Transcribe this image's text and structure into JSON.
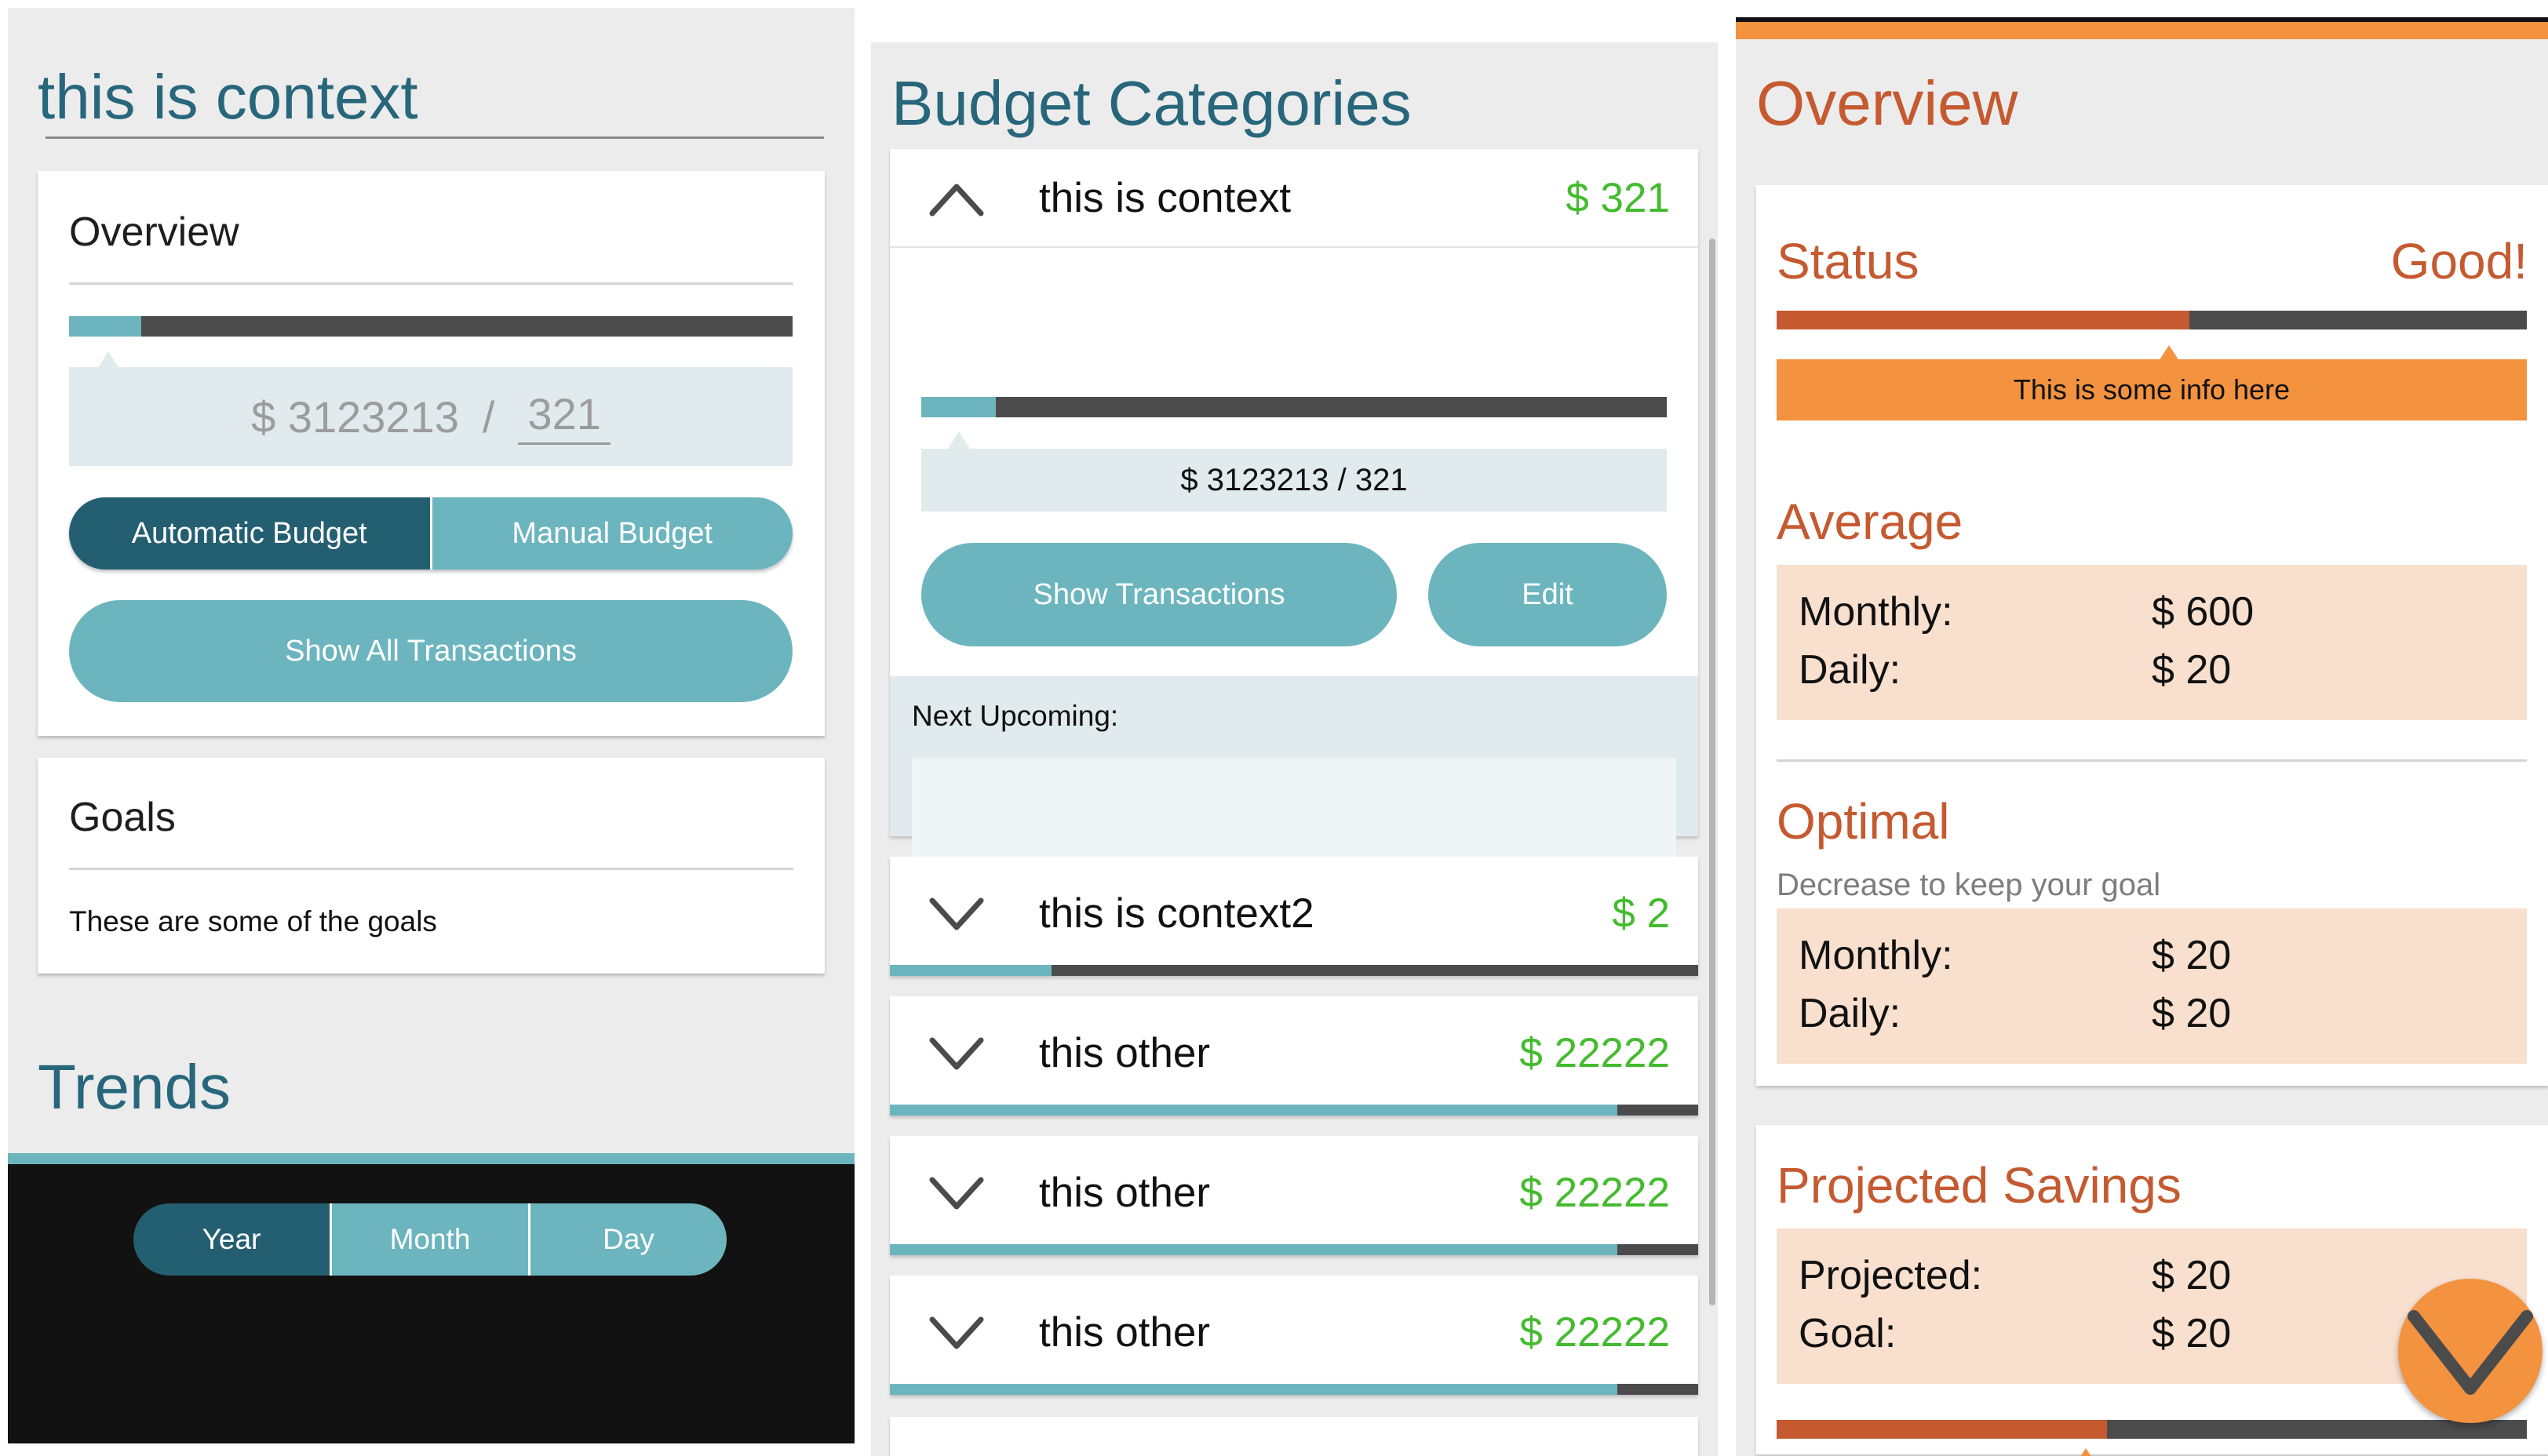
{
  "panel1": {
    "context_title": "this is context",
    "overview": {
      "title": "Overview",
      "progress": 0.1,
      "spent": "$ 3123213",
      "separator": "/",
      "limit": "321"
    },
    "budget_toggle": {
      "automatic": "Automatic Budget",
      "manual": "Manual Budget",
      "selected": "Automatic Budget"
    },
    "show_all_label": "Show All Transactions",
    "goals": {
      "title": "Goals",
      "text": "These are some of the goals"
    },
    "trends": {
      "title": "Trends",
      "periods": [
        "Year",
        "Month",
        "Day"
      ],
      "selected": "Year"
    }
  },
  "panel2": {
    "title": "Budget Categories",
    "expanded": {
      "name": "this is context",
      "amount": "$ 321",
      "progress": 0.1,
      "amount_line": "$ 3123213 / 321",
      "show_transactions_label": "Show Transactions",
      "edit_label": "Edit",
      "next_upcoming_label": "Next Upcoming:"
    },
    "categories": [
      {
        "name": "this is context2",
        "amount": "$ 2",
        "progress": 0.2
      },
      {
        "name": "this other",
        "amount": "$ 22222",
        "progress": 0.9
      },
      {
        "name": "this other",
        "amount": "$ 22222",
        "progress": 0.9
      },
      {
        "name": "this other",
        "amount": "$ 22222",
        "progress": 0.9
      }
    ]
  },
  "panel3": {
    "title": "Overview",
    "status": {
      "label": "Status",
      "value": "Good!",
      "progress": 0.55,
      "info": "This is some info here"
    },
    "average": {
      "title": "Average",
      "monthly_label": "Monthly:",
      "monthly_value": "$ 600",
      "daily_label": "Daily:",
      "daily_value": "$ 20"
    },
    "optimal": {
      "title": "Optimal",
      "subtitle": "Decrease to keep your goal",
      "monthly_label": "Monthly:",
      "monthly_value": "$ 20",
      "daily_label": "Daily:",
      "daily_value": "$ 20"
    },
    "projected": {
      "title": "Projected Savings",
      "projected_label": "Projected:",
      "projected_value": "$ 20",
      "goal_label": "Goal:",
      "goal_value": "$ 20",
      "progress": 0.44
    }
  },
  "colors": {
    "teal": "#6cb5bf",
    "teal_dark": "#245e71",
    "heading_teal": "#27667b",
    "orange": "#f3923f",
    "rust": "#c55a31",
    "positive_green": "#44bb2f",
    "bar_dark": "#4b4b4b"
  },
  "icons": {
    "expanded_category": "chevron-up-icon",
    "collapsed_category": "chevron-down-icon",
    "fab": "chevron-down-icon"
  }
}
